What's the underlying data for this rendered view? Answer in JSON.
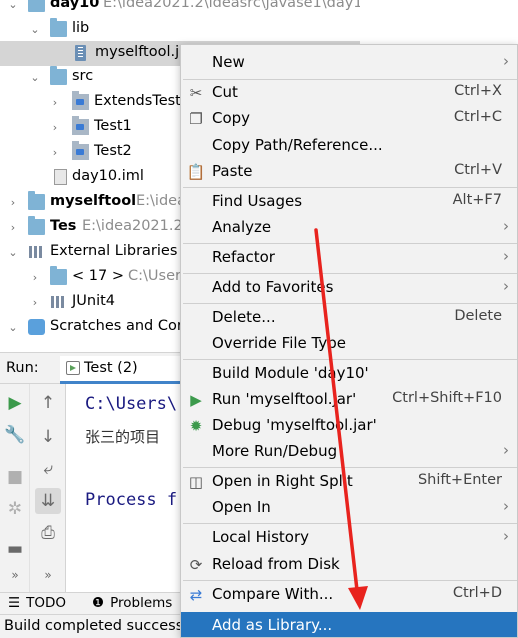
{
  "tree": {
    "rows": [
      {
        "label": "day10",
        "extra": "E:\\idea2021.2\\ideasrc\\javase1\\day1",
        "bold": true
      },
      {
        "label": "lib"
      },
      {
        "label": "myselftool.j"
      },
      {
        "label": "src"
      },
      {
        "label": "ExtendsTest"
      },
      {
        "label": "Test1"
      },
      {
        "label": "Test2"
      },
      {
        "label": "day10.iml"
      },
      {
        "label": "myselftool",
        "extra": "E:\\idea",
        "bold": true
      },
      {
        "label": "Tes",
        "extra": "E:\\idea2021.2\\",
        "bold": true
      },
      {
        "label": "External Libraries"
      },
      {
        "label": "< 17 >",
        "extra": "C:\\User"
      },
      {
        "label": "JUnit4"
      },
      {
        "label": "Scratches and Cor"
      }
    ]
  },
  "run_panel": {
    "label": "Run:",
    "tab_label": "Test (2)",
    "console_lines": [
      "C:\\Users\\",
      "张三的项目",
      "Process f"
    ]
  },
  "tool_windows": {
    "todo": "TODO",
    "problems": "Problems"
  },
  "status_bar": {
    "text": "Build completed success"
  },
  "context_menu": {
    "items": [
      {
        "label": "New",
        "submenu": true
      },
      {
        "label": "Cut",
        "shortcut": "Ctrl+X",
        "icon": "scissors-icon"
      },
      {
        "label": "Copy",
        "shortcut": "Ctrl+C",
        "icon": "copy-icon"
      },
      {
        "label": "Copy Path/Reference..."
      },
      {
        "label": "Paste",
        "shortcut": "Ctrl+V",
        "icon": "paste-icon"
      },
      {
        "label": "Find Usages",
        "shortcut": "Alt+F7"
      },
      {
        "label": "Analyze",
        "submenu": true
      },
      {
        "label": "Refactor",
        "submenu": true
      },
      {
        "label": "Add to Favorites",
        "submenu": true
      },
      {
        "label": "Delete...",
        "shortcut": "Delete"
      },
      {
        "label": "Override File Type"
      },
      {
        "label": "Build Module 'day10'"
      },
      {
        "label": "Run 'myselftool.jar'",
        "shortcut": "Ctrl+Shift+F10",
        "icon": "run-icon"
      },
      {
        "label": "Debug 'myselftool.jar'",
        "icon": "debug-icon"
      },
      {
        "label": "More Run/Debug",
        "submenu": true
      },
      {
        "label": "Open in Right Split",
        "shortcut": "Shift+Enter",
        "icon": "split-icon"
      },
      {
        "label": "Open In",
        "submenu": true
      },
      {
        "label": "Local History",
        "submenu": true
      },
      {
        "label": "Reload from Disk",
        "icon": "reload-icon"
      },
      {
        "label": "Compare With...",
        "shortcut": "Ctrl+D",
        "icon": "compare-icon"
      },
      {
        "label": "Add as Library...",
        "highlighted": true
      }
    ]
  },
  "colors": {
    "menu_highlight": "#2675bf",
    "annotation_arrow": "#e8231e",
    "selection": "#d5d5d5"
  }
}
